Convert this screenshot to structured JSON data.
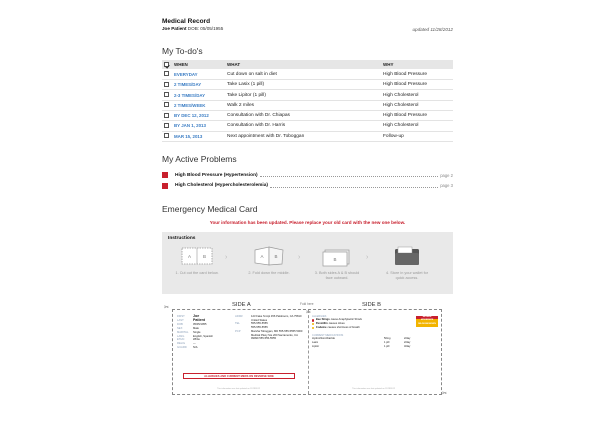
{
  "header": {
    "title": "Medical Record",
    "patient_name": "Joe Patient",
    "dob": "DOB: 05/05/1955",
    "updated": "updated 11/28/2012"
  },
  "todos": {
    "title": "My To-do's",
    "columns": {
      "when": "WHEN",
      "what": "WHAT",
      "why": "WHY"
    },
    "rows": [
      {
        "when": "EVERYDAY",
        "what": "Cut down on salt in diet",
        "why": "High Blood Pressure"
      },
      {
        "when": "2 TIMES/DAY",
        "what": "Take Lasix (1 pill)",
        "why": "High Blood Pressure"
      },
      {
        "when": "2-3 TIMES/DAY",
        "what": "Take Lipitor (1 pill)",
        "why": "High Cholesterol"
      },
      {
        "when": "2 TIMES/WEEK",
        "what": "Walk 2 miles",
        "why": "High Cholesterol"
      },
      {
        "when": "BY DEC 12, 2012",
        "what": "Consultation with Dr. Chiapas",
        "why": "High Blood Pressure"
      },
      {
        "when": "BY JAN 1, 2013",
        "what": "Consultation with Dr. Harris",
        "why": "High Cholesterol"
      },
      {
        "when": "MAR 15, 2013",
        "what": "Next appointment with Dr. Toboggan",
        "why": "Follow-up"
      }
    ]
  },
  "problems": {
    "title": "My Active Problems",
    "items": [
      {
        "name": "High Blood Pressure (Hypertension)",
        "page": "page 2"
      },
      {
        "name": "High Cholesterol (Hypercholesterolemia)",
        "page": "page 3"
      }
    ]
  },
  "emergency": {
    "title": "Emergency Medical Card",
    "alert": "Your information has been updated. Please replace your old card with the new one below.",
    "instructions_title": "Instructions",
    "steps": [
      "1. Cut out the card below.",
      "2. Fold down the middle.",
      "3. Both sides A & B should face outward.",
      "4. Store in your wallet for quick access."
    ],
    "side_a": "SIDE A",
    "side_b": "SIDE B",
    "fold_label": "Fold here",
    "card": {
      "a_fields": [
        {
          "k": "FIRST",
          "v": "Joe"
        },
        {
          "k": "LAST",
          "v": "Patient"
        },
        {
          "k": "DOB",
          "v": "05/05/1955"
        },
        {
          "k": "SEX",
          "v": "Male"
        },
        {
          "k": "MARITAL",
          "v": "Single"
        },
        {
          "k": "LANG",
          "v": "English, Spanish"
        },
        {
          "k": "ETHN",
          "v": "White"
        },
        {
          "k": "RELIG",
          "v": "—"
        },
        {
          "k": "GUARD",
          "v": "N/A"
        }
      ],
      "address_label": "ADDR",
      "address": "123 Fake St Apt 456 Paloboom, CA 75810 United States",
      "tel_label": "TEL",
      "tel": "555-555-5555",
      "tel2": "555-555-5555",
      "pcp_label": "PCP",
      "pcp": "Marsha Toboggan, MD 555-555-5555 5000 Medical Pkwy Ste 200 Sacramento, CA 99999 555-555-5555",
      "allergy_box": "ALLERGIES AND CURRENT MEDS ON REVERSE SIDE",
      "printed_note": "This information was last updated on 11/28/2012",
      "allergies_label": "ALLERGIES",
      "allergies": [
        {
          "name": "Bee Stings",
          "reaction": "cause Anaphylactic Shock",
          "color": "#c8202e"
        },
        {
          "name": "Penicillin",
          "reaction": "causes Hives",
          "color": "#f2b400"
        },
        {
          "name": "Codeine",
          "reaction": "causes shortness of breath",
          "color": "#f2b400"
        }
      ],
      "meds_label": "CURRENT MEDICATIONS",
      "meds": [
        {
          "name": "Hydrochlorothiazide",
          "dose": "50mg",
          "freq": "2/day"
        },
        {
          "name": "Lasix",
          "dose": "1 pill",
          "freq": "2/day"
        },
        {
          "name": "Lipitor",
          "dose": "1 pill",
          "freq": "3/day"
        }
      ],
      "severity": [
        {
          "label": "SEVERE",
          "color": "#c8202e"
        },
        {
          "label": "MODERATE",
          "color": "#f2b400"
        },
        {
          "label": "MILD/UNKNOWN",
          "color": "#f2b400"
        }
      ]
    }
  },
  "colors": {
    "accent_blue": "#3b7dc4",
    "alert_red": "#c8202e",
    "warning_yellow": "#f2b400"
  }
}
